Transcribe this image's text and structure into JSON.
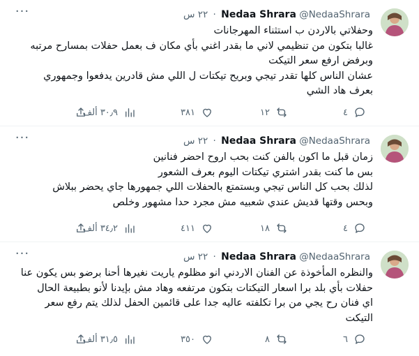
{
  "tweets": [
    {
      "name": "Nedaa Shrara",
      "handle": "@NedaaShrara",
      "separator": "·",
      "time": "٢٢ س",
      "more": "···",
      "lines": [
        "وحفلاتي بالاردن ب استثناء المهرجانات",
        "غالبا بتكون من تنظيمي لاني ما بقدر اغني بأي مكان ف بعمل حفلات بمسارح مرتبه",
        "وبرفض ارفع سعر التيكت",
        "عشان الناس كلها تقدر تيجي وبريح تيكتات ل اللي مش قادرين يدفعوا وجمهوري",
        "بعرف هاد الشي"
      ],
      "replies": "٤",
      "retweets": "١٢",
      "likes": "٣٨١",
      "views": "٣٠٫٩ ألف"
    },
    {
      "name": "Nedaa Shrara",
      "handle": "@NedaaShrara",
      "separator": "·",
      "time": "٢٢ س",
      "more": "···",
      "lines": [
        "زمان قبل ما اكون بالفن كنت بحب اروح احضر فنانين",
        "بس ما كنت بقدر اشتري تيكتات اليوم بعرف الشعور",
        "لذلك بحب كل الناس تيجي وبستمتع بالحفلات اللي جمهورها جاي يحضر ببلاش",
        "وبحس وقتها قديش عندي شعبيه مش مجرد حدا مشهور وخلص"
      ],
      "replies": "٤",
      "retweets": "١٨",
      "likes": "٤١١",
      "views": "٣٤٫٢ ألف"
    },
    {
      "name": "Nedaa Shrara",
      "handle": "@NedaaShrara",
      "separator": "·",
      "time": "٢٢ س",
      "more": "···",
      "lines": [
        "والنظره المأخوذة عن الفنان الاردني انو مظلوم ياريت نغيرها أحنا برضو بس يكون عنا",
        "حفلات بأي بلد برا اسعار التيكتات بتكون مرتفعه وهاد مش بإيدنا لأنو بطبيعة الحال",
        "اي فنان رح يجي من برا تكلفته عاليه جدا على قائمين الحفل لذلك يتم رفع سعر",
        "التيكت"
      ],
      "replies": "٦",
      "retweets": "٨",
      "likes": "٣٥٠",
      "views": "٣١٫٥ ألف"
    }
  ],
  "colors": {
    "text": "#0f1419",
    "muted": "#536471",
    "divider": "#eff3f4"
  },
  "icons": [
    "avatar",
    "more-icon",
    "reply-icon",
    "retweet-icon",
    "like-icon",
    "views-icon",
    "share-icon"
  ]
}
